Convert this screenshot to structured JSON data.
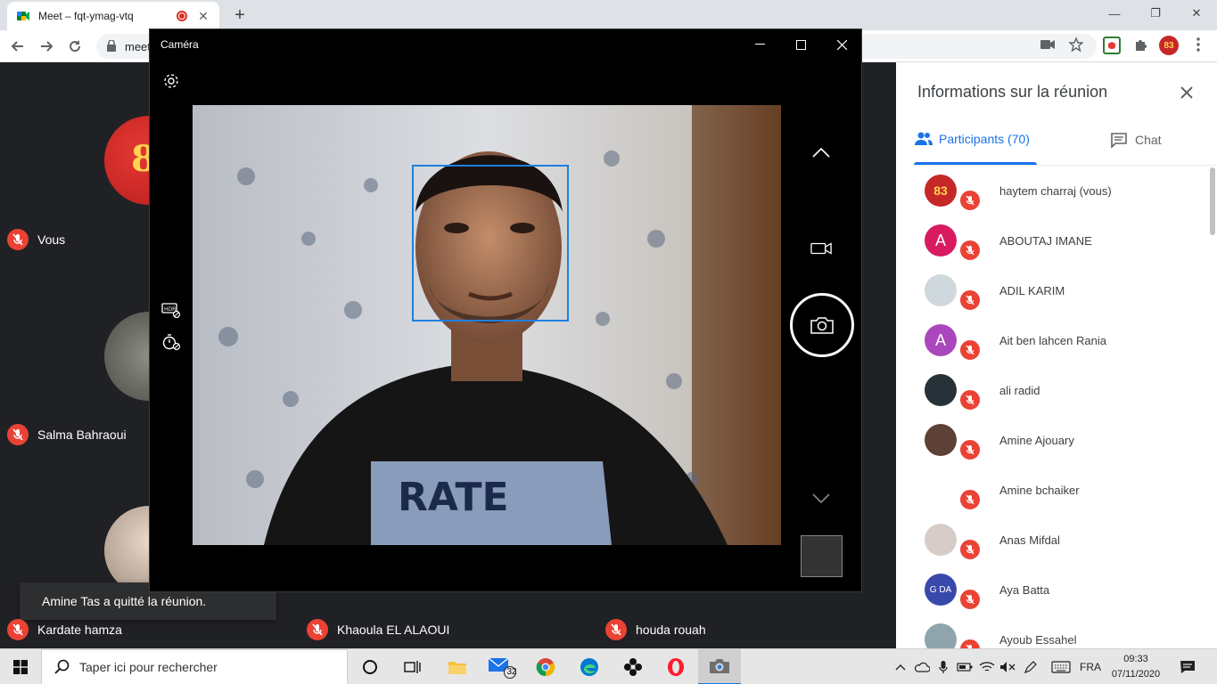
{
  "browser": {
    "tab_title": "Meet – fqt-ymag-vtq",
    "url_visible": "meet",
    "new_tab_symbol": "+",
    "tab_close_symbol": "✕",
    "minimize": "—",
    "restore": "❐",
    "close": "✕"
  },
  "camera_app": {
    "title": "Caméra"
  },
  "meet": {
    "tiles": [
      {
        "name": "Vous"
      },
      {
        "name": "Salma Bahraoui"
      },
      {
        "name": "Kardate hamza"
      },
      {
        "name": "Khaoula EL ALAOUI"
      },
      {
        "name": "houda rouah"
      }
    ],
    "toast": "Amine Tas a quitté la réunion."
  },
  "panel": {
    "title": "Informations sur la réunion",
    "tab_participants": "Participants (70)",
    "tab_chat": "Chat",
    "participants": [
      {
        "name": "haytem charraj (vous)",
        "avatar": "83",
        "color": "#c62828"
      },
      {
        "name": "ABOUTAJ IMANE",
        "avatar": "A",
        "color": "#d81b60"
      },
      {
        "name": "ADIL KARIM",
        "avatar": "",
        "color": "#cfd8dc"
      },
      {
        "name": "Ait ben lahcen Rania",
        "avatar": "A",
        "color": "#ab47bc"
      },
      {
        "name": "ali radid",
        "avatar": "",
        "color": "#263238"
      },
      {
        "name": "Amine Ajouary",
        "avatar": "",
        "color": "#5d4037"
      },
      {
        "name": "Amine bchaiker",
        "avatar": "",
        "color": "#ffffff"
      },
      {
        "name": "Anas Mifdal",
        "avatar": "",
        "color": "#d7ccc8"
      },
      {
        "name": "Aya Batta",
        "avatar": "G DA",
        "color": "#3949ab"
      },
      {
        "name": "Ayoub Essahel",
        "avatar": "",
        "color": "#90a4ae"
      }
    ]
  },
  "taskbar": {
    "search_placeholder": "Taper ici pour rechercher",
    "mail_badge": "32",
    "language": "FRA",
    "time": "09:33",
    "date": "07/11/2020"
  }
}
